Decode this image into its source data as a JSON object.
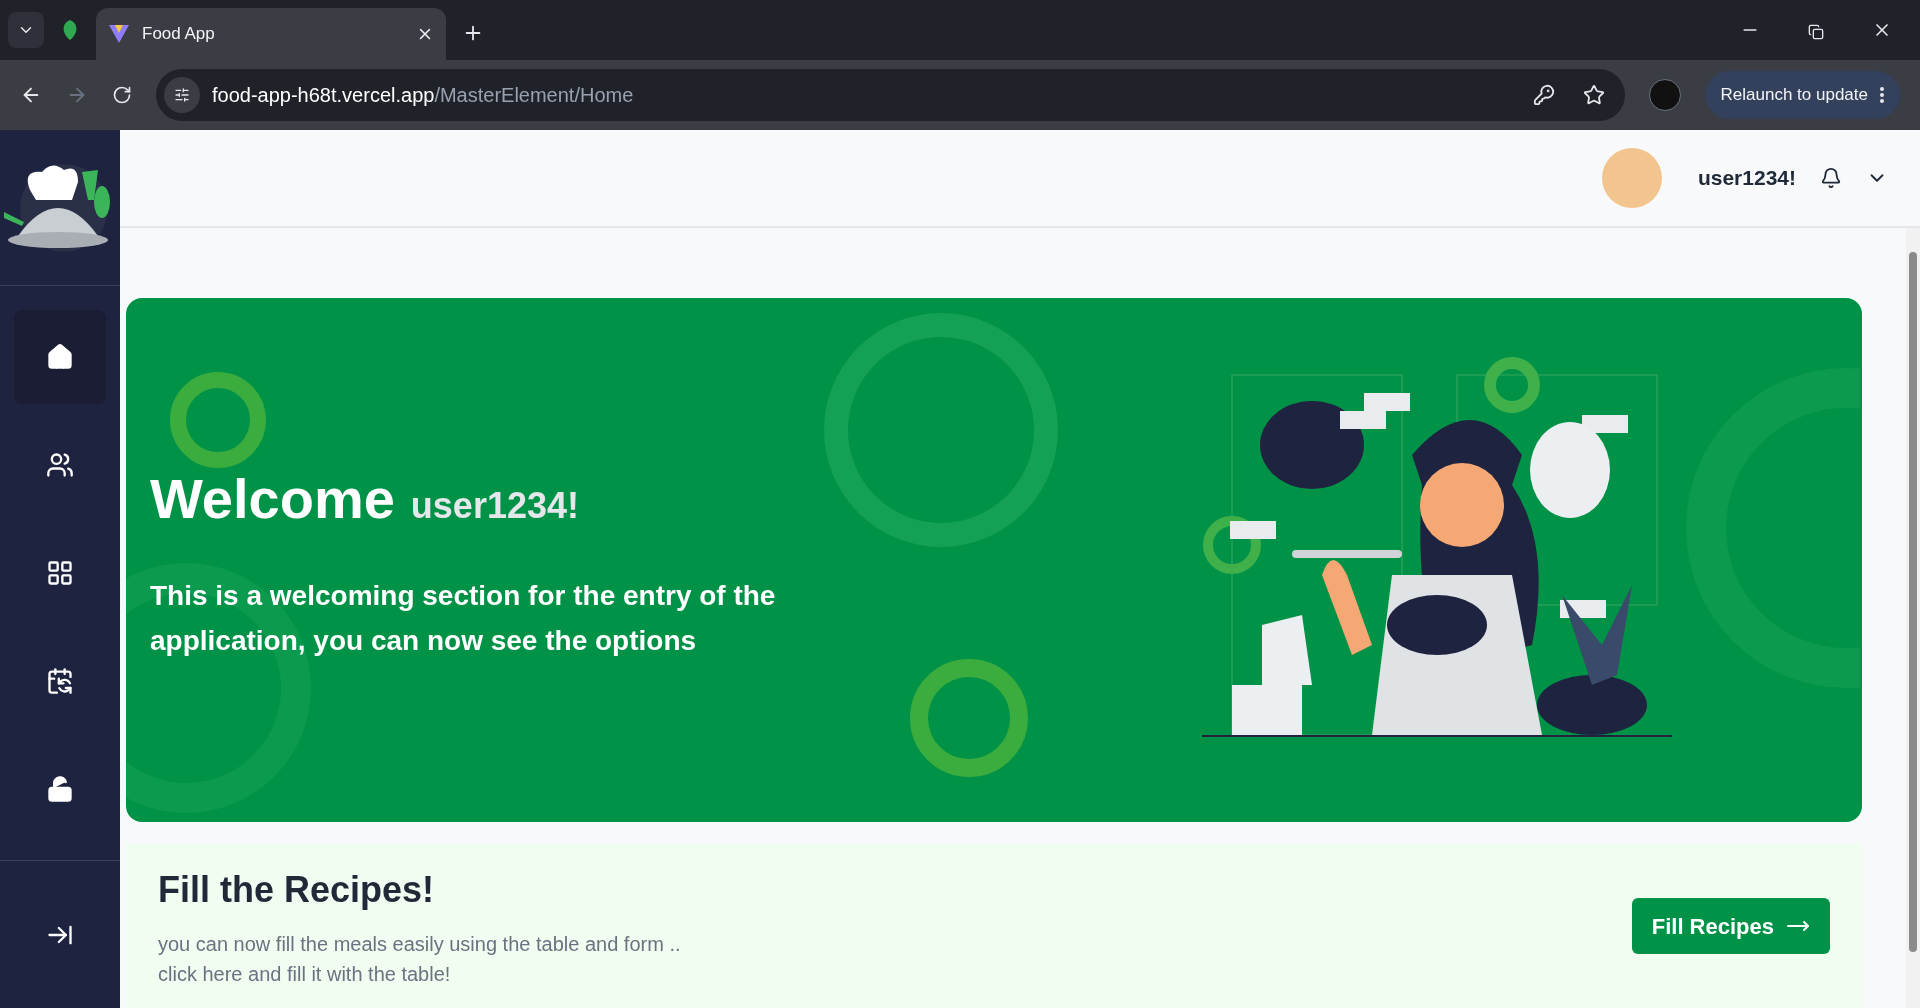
{
  "browser": {
    "tab_title": "Food App",
    "url_host": "food-app-h68t.vercel.app",
    "url_path": "/MasterElement/Home",
    "relaunch": "Relaunch to update"
  },
  "sidebar": {
    "items": [
      {
        "selected": true
      },
      {
        "selected": false
      },
      {
        "selected": false
      },
      {
        "selected": false
      },
      {
        "selected": false
      }
    ]
  },
  "header": {
    "username": "user1234!"
  },
  "banner": {
    "title": "Welcome",
    "username": "user1234!",
    "text": "This is a welcoming section for the entry of the application, you can now see the options"
  },
  "card": {
    "title": "Fill the Recipes!",
    "lines": [
      "you can now fill the meals easily using the table and form ..",
      "click here and fill it with the table!"
    ],
    "button": "Fill Recipes"
  }
}
